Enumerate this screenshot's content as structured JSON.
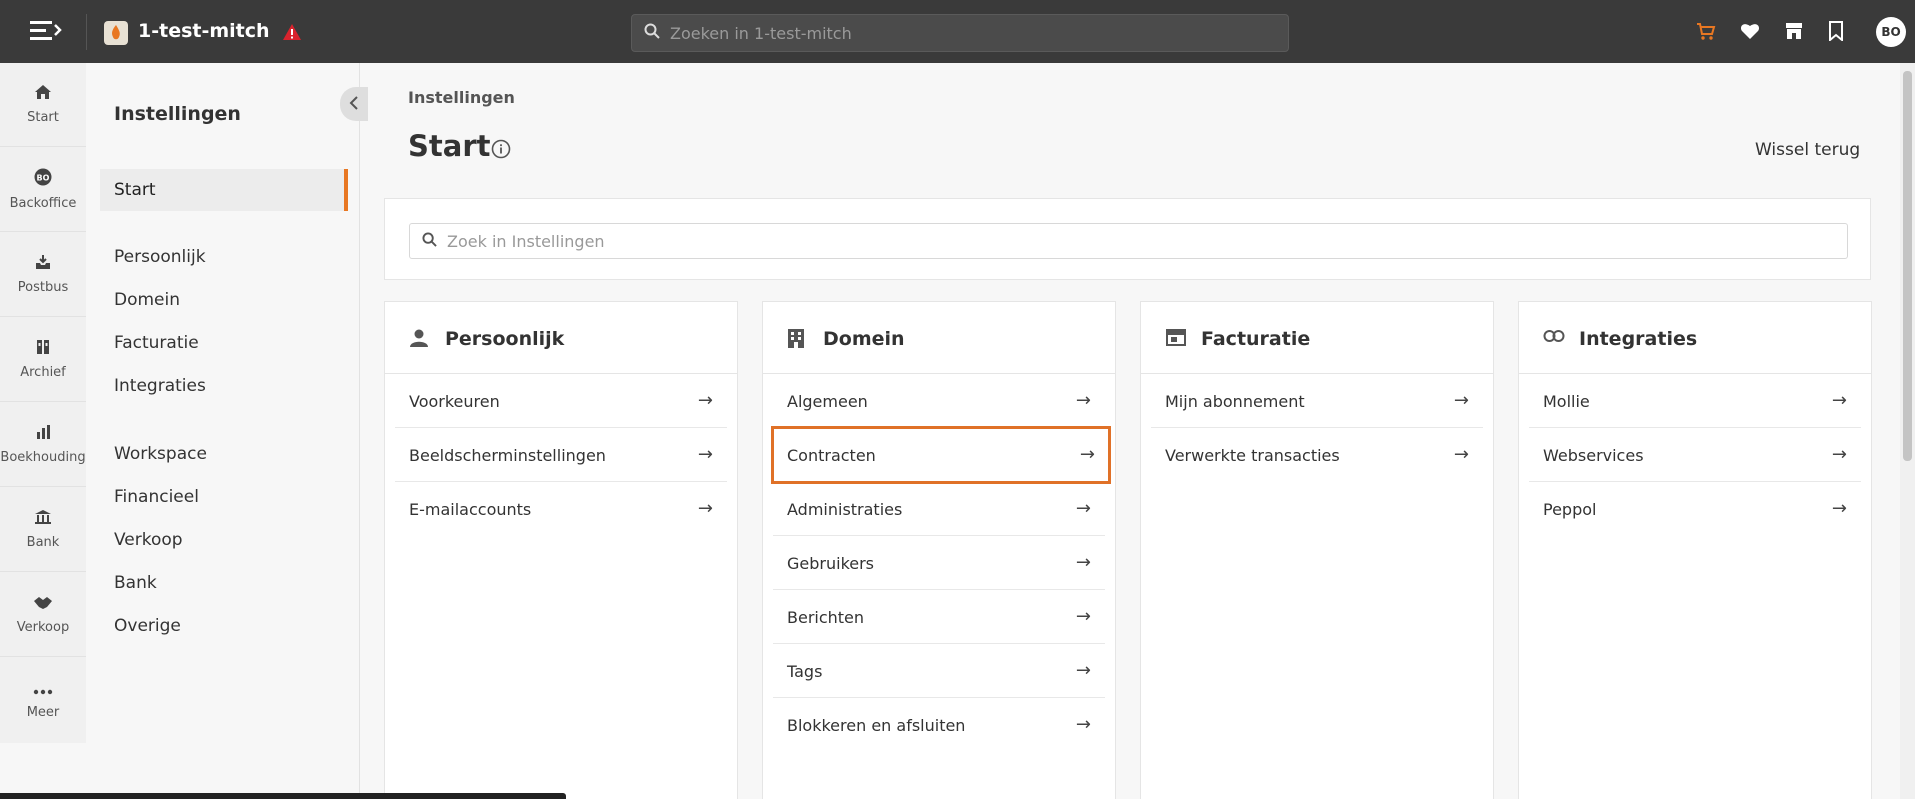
{
  "topbar": {
    "app_title": "1-test-mitch",
    "search_placeholder": "Zoeken in 1-test-mitch",
    "avatar_initials": "BO",
    "cart_color": "#e87722"
  },
  "rail": {
    "items": [
      {
        "label": "Start",
        "icon": "home-icon"
      },
      {
        "label": "Backoffice",
        "icon": "bo-badge-icon"
      },
      {
        "label": "Postbus",
        "icon": "inbox-icon"
      },
      {
        "label": "Archief",
        "icon": "archive-icon"
      },
      {
        "label": "Boekhouding",
        "icon": "bar-chart-icon"
      },
      {
        "label": "Bank",
        "icon": "bank-icon"
      },
      {
        "label": "Verkoop",
        "icon": "handshake-icon"
      },
      {
        "label": "Meer",
        "icon": "more-icon"
      }
    ]
  },
  "nav": {
    "title": "Instellingen",
    "active": "Start",
    "group1": [
      "Persoonlijk",
      "Domein",
      "Facturatie",
      "Integraties"
    ],
    "group2": [
      "Workspace",
      "Financieel",
      "Verkoop",
      "Bank",
      "Overige"
    ]
  },
  "main": {
    "breadcrumb": "Instellingen",
    "title": "Start",
    "switch_label": "Wissel terug",
    "search_placeholder": "Zoek in Instellingen",
    "cards": [
      {
        "title": "Persoonlijk",
        "items": [
          "Voorkeuren",
          "Beeldschermin­stellingen",
          "E-mailaccounts"
        ]
      },
      {
        "title": "Domein",
        "items": [
          "Algemeen",
          "Contracten",
          "Administraties",
          "Gebruikers",
          "Berichten",
          "Tags",
          "Blokkeren en afsluiten"
        ]
      },
      {
        "title": "Facturatie",
        "items": [
          "Mijn abonnement",
          "Verwerkte transacties"
        ]
      },
      {
        "title": "Integraties",
        "items": [
          "Mollie",
          "Webservices",
          "Peppol"
        ]
      }
    ],
    "highlight_color": "#e07128",
    "arrow": "→"
  }
}
